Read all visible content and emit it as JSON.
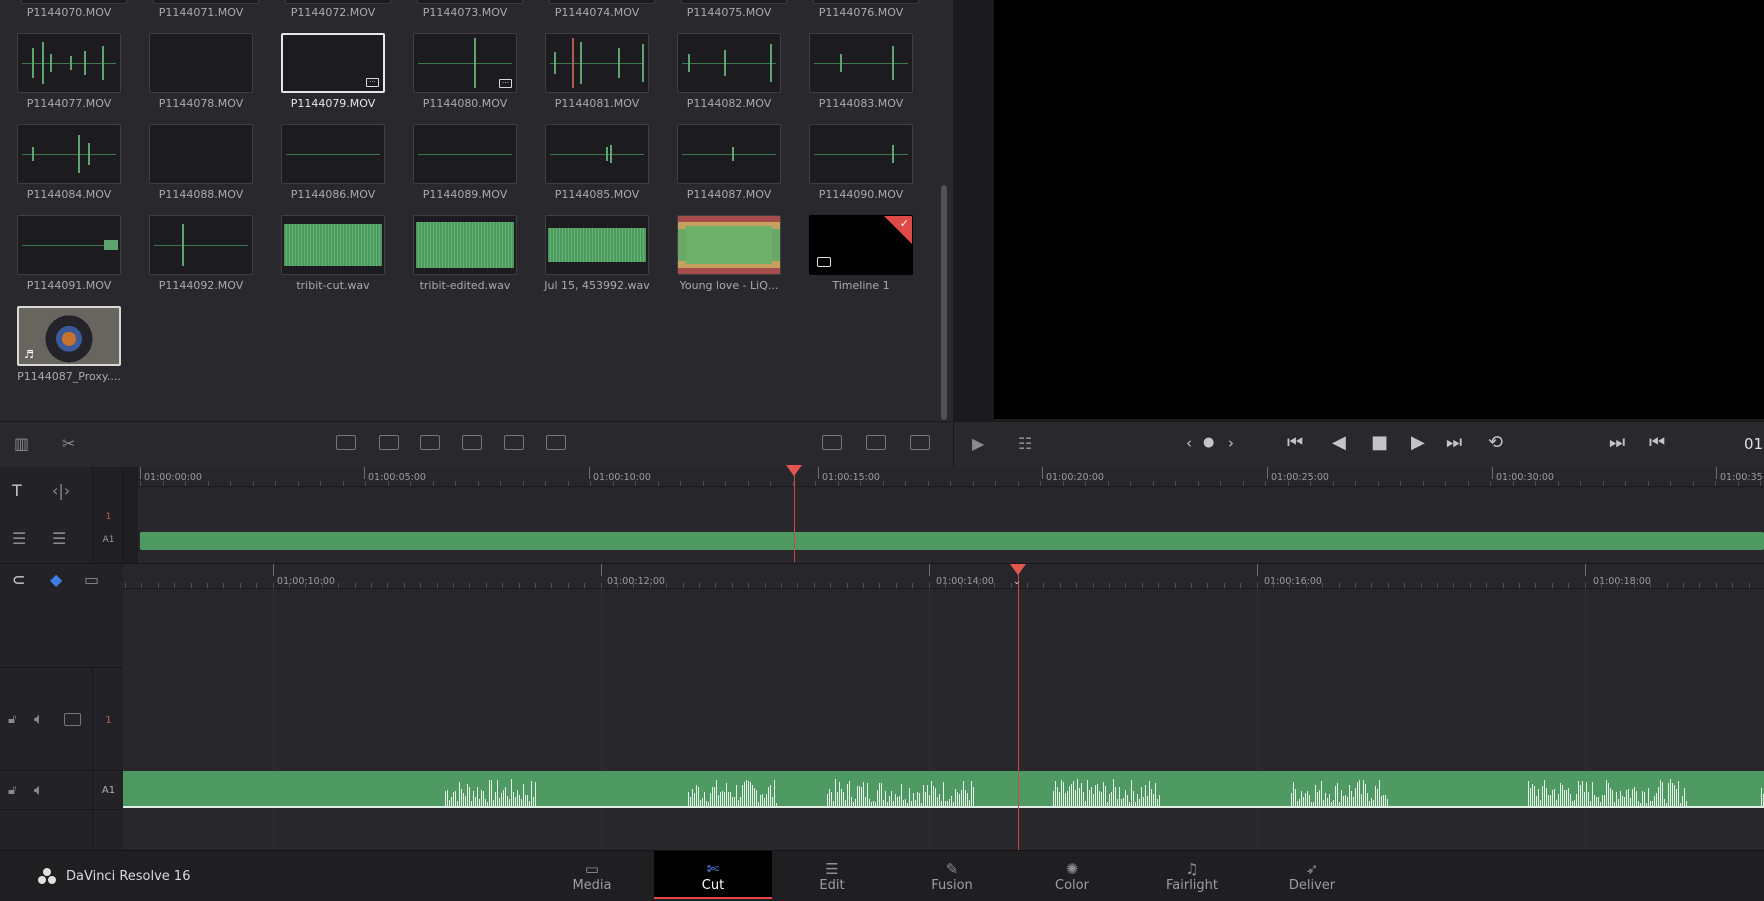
{
  "app": {
    "name": "DaVinci Resolve 16"
  },
  "media_pool": {
    "top_row": [
      "P1144070.MOV",
      "P1144071.MOV",
      "P1144072.MOV",
      "P1144073.MOV",
      "P1144074.MOV",
      "P1144075.MOV",
      "P1144076.MOV"
    ],
    "clips": [
      [
        "P1144077.MOV",
        "P1144078.MOV",
        "P1144079.MOV",
        "P1144080.MOV",
        "P1144081.MOV",
        "P1144082.MOV",
        "P1144083.MOV"
      ],
      [
        "P1144084.MOV",
        "P1144088.MOV",
        "P1144086.MOV",
        "P1144089.MOV",
        "P1144085.MOV",
        "P1144087.MOV",
        "P1144090.MOV"
      ],
      [
        "P1144091.MOV",
        "P1144092.MOV",
        "tribit-cut.wav",
        "tribit-edited.wav",
        "Jul 15, 453992.wav",
        "Young love - LiQ...",
        "Timeline 1"
      ],
      [
        "P1144087_Proxy...."
      ]
    ],
    "selected": "P1144079.MOV"
  },
  "upper_ruler": [
    "01:00:00:00",
    "01:00:05:00",
    "01:00:10:00",
    "01:00:15:00",
    "01:00:20:00",
    "01:00:25:00",
    "01:00:30:00",
    "01:00:35"
  ],
  "lower_ruler": [
    "01:00:10:00",
    "01:00:12:00",
    "01:00:14:00",
    "01:00:16:00",
    "01:00:18:00"
  ],
  "tracks": {
    "video": "1",
    "audio": "A1"
  },
  "timecode": "01",
  "pages": [
    {
      "label": "Media",
      "icon": "media-icon"
    },
    {
      "label": "Cut",
      "icon": "cut-icon"
    },
    {
      "label": "Edit",
      "icon": "edit-icon"
    },
    {
      "label": "Fusion",
      "icon": "fusion-icon"
    },
    {
      "label": "Color",
      "icon": "color-icon"
    },
    {
      "label": "Fairlight",
      "icon": "fairlight-icon"
    },
    {
      "label": "Deliver",
      "icon": "deliver-icon"
    }
  ],
  "active_page": "Cut",
  "colors": {
    "accent_red": "#e4564f",
    "clip_green": "#4f9a63",
    "active_tab_icon": "#6a8cff"
  }
}
